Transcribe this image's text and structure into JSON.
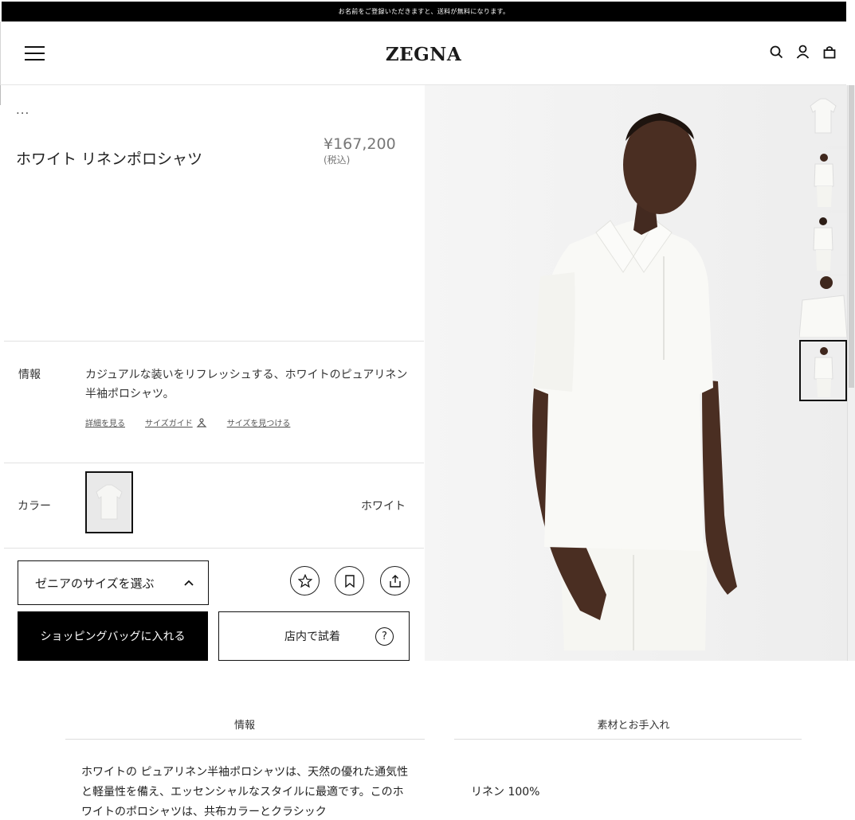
{
  "promo": {
    "text": "お名前をご登録いただきますと、送料が無料になります。"
  },
  "header": {
    "logo": "ZEGNA"
  },
  "product": {
    "breadcrumb": "...",
    "title": "ホワイト リネンポロシャツ",
    "price": "¥167,200",
    "tax_note": "(税込)"
  },
  "info": {
    "label": "情報",
    "text": "カジュアルな装いをリフレッシュする、ホワイトのピュアリネン半袖ポロシャツ。",
    "links": {
      "details": "詳細を見る",
      "size_guide": "サイズガイド",
      "find_size": "サイズを見つける"
    }
  },
  "color": {
    "label": "カラー",
    "name": "ホワイト"
  },
  "actions": {
    "size_select": "ゼニアのサイズを選ぶ",
    "add_to_bag": "ショッピングバッグに入れる",
    "try_in_store": "店内で試着",
    "help_glyph": "?"
  },
  "details": {
    "tab_info": "情報",
    "tab_material": "素材とお手入れ",
    "description": "ホワイトの ピュアリネン半袖ポロシャツは、天然の優れた通気性と軽量性を備え、エッセンシャルなスタイルに最適です。このホワイトのポロシャツは、共布カラーとクラシック",
    "material": "リネン 100%"
  },
  "icons": {
    "menu": "hamburger-icon",
    "search": "search-icon",
    "account": "user-icon",
    "bag": "shopping-bag-icon",
    "wishlist": "star-icon",
    "save": "bookmark-icon",
    "share": "share-icon"
  }
}
